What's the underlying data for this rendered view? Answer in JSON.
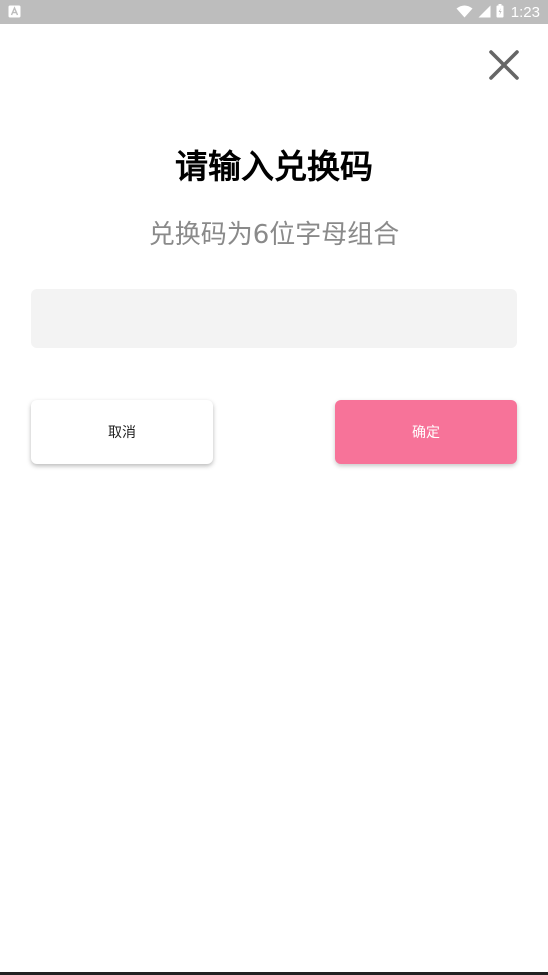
{
  "status_bar": {
    "time": "1:23",
    "icons": [
      "notification-a-icon",
      "wifi-icon",
      "signal-icon",
      "battery-icon"
    ]
  },
  "dialog": {
    "title": "请输入兑换码",
    "subtitle": "兑换码为6位字母组合",
    "input": {
      "value": "",
      "placeholder": ""
    },
    "cancel_label": "取消",
    "confirm_label": "确定",
    "close_icon": "close-icon"
  },
  "colors": {
    "status_bar_bg": "#bdbdbd",
    "accent": "#f77399",
    "input_bg": "#f3f3f3",
    "subtitle_text": "#8a8a8a"
  }
}
